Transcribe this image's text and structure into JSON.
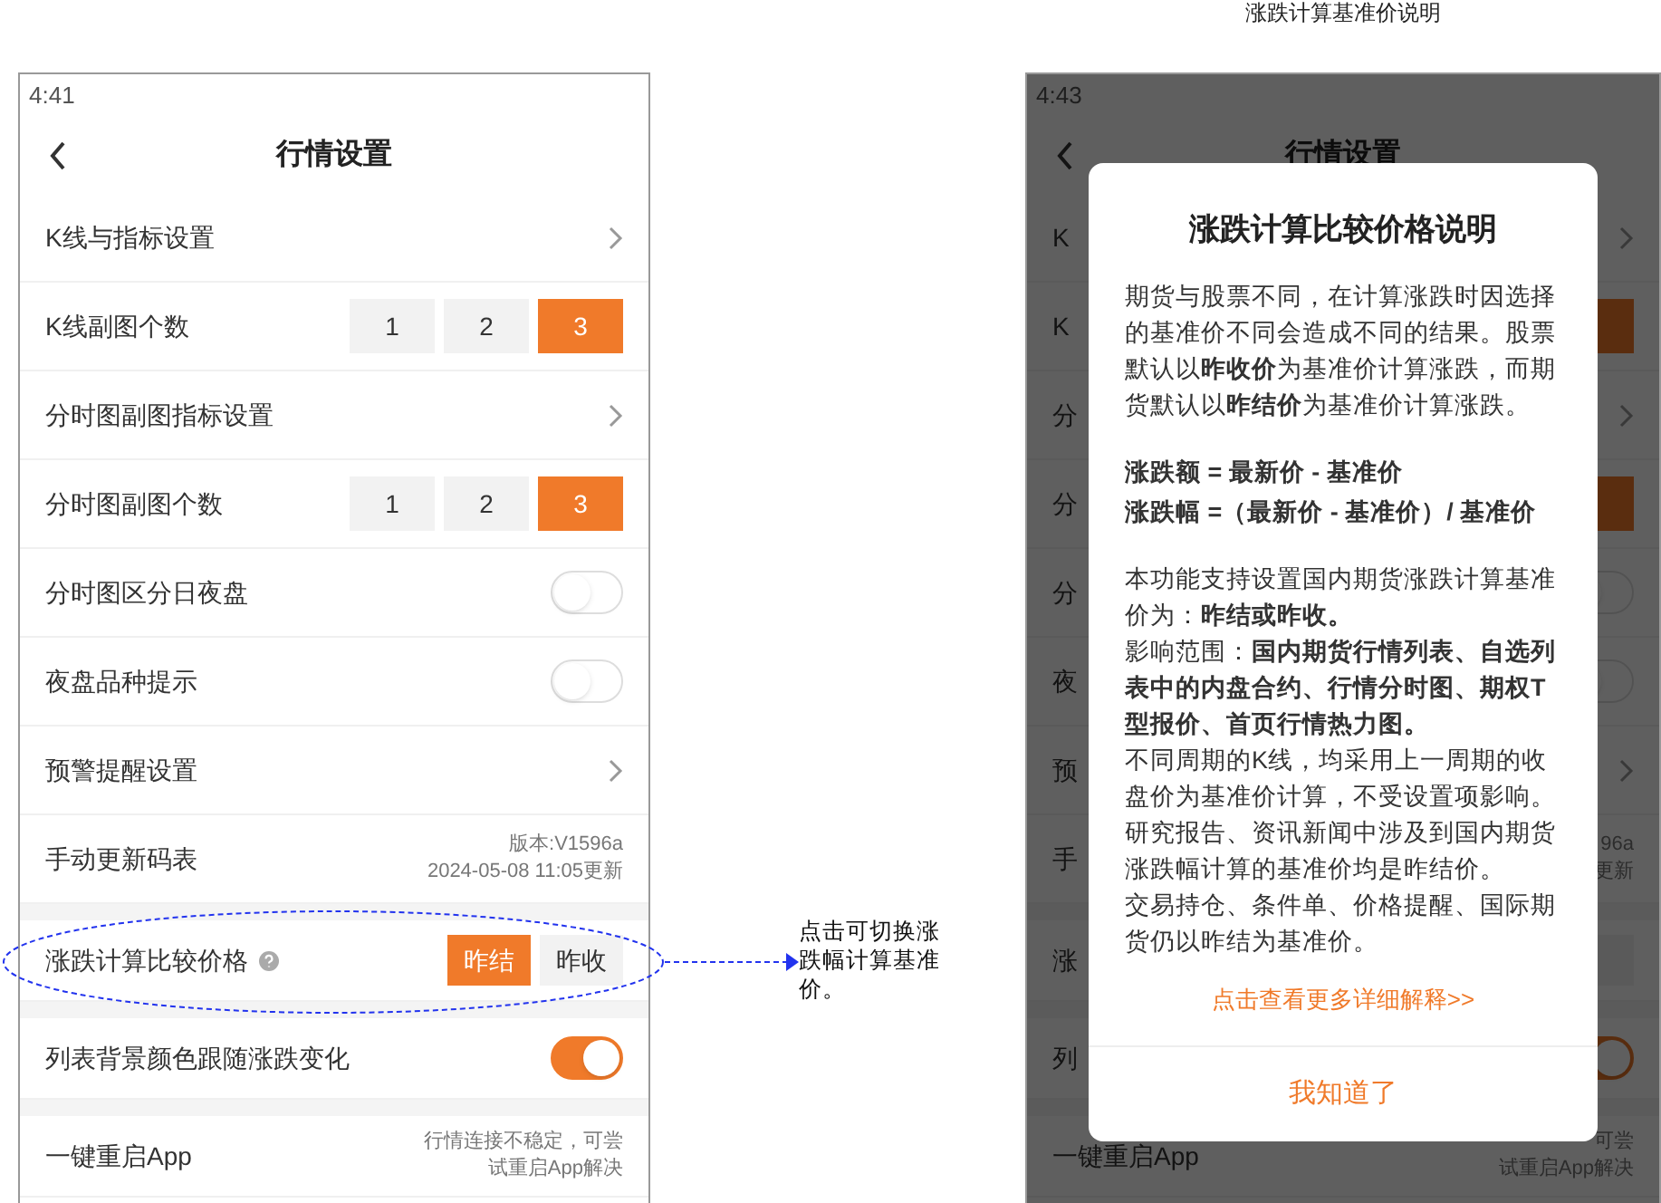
{
  "caption": "涨跌计算基准价说明",
  "annotation": "点击可切换涨跌幅计算基准价。",
  "left_screen": {
    "time": "4:41",
    "title": "行情设置",
    "sections": [
      [
        {
          "kind": "link",
          "label": "K线与指标设置"
        },
        {
          "kind": "segment",
          "label": "K线副图个数",
          "options": [
            {
              "label": "1",
              "selected": false
            },
            {
              "label": "2",
              "selected": false
            },
            {
              "label": "3",
              "selected": true
            }
          ]
        },
        {
          "kind": "link",
          "label": "分时图副图指标设置"
        },
        {
          "kind": "segment",
          "label": "分时图副图个数",
          "options": [
            {
              "label": "1",
              "selected": false
            },
            {
              "label": "2",
              "selected": false
            },
            {
              "label": "3",
              "selected": true
            }
          ]
        },
        {
          "kind": "toggle",
          "label": "分时图区分日夜盘",
          "on": false
        },
        {
          "kind": "toggle",
          "label": "夜盘品种提示",
          "on": false
        },
        {
          "kind": "link",
          "label": "预警提醒设置"
        },
        {
          "kind": "info",
          "label": "手动更新码表",
          "lines": [
            "版本:V1596a",
            "2024-05-08 11:05更新"
          ]
        }
      ],
      [
        {
          "kind": "choice",
          "label": "涨跌计算比较价格",
          "options": [
            {
              "label": "昨结",
              "selected": true
            },
            {
              "label": "昨收",
              "selected": false
            }
          ]
        }
      ],
      [
        {
          "kind": "toggle",
          "label": "列表背景颜色跟随涨跌变化",
          "on": true
        }
      ],
      [
        {
          "kind": "info",
          "label": "一键重启App",
          "lines": [
            "行情连接不稳定，可尝",
            "试重启App解决"
          ]
        }
      ]
    ]
  },
  "right_screen": {
    "time": "4:43",
    "title": "行情设置",
    "sections": [
      [
        {
          "kind": "link",
          "label": "K"
        },
        {
          "kind": "block",
          "label": "K"
        },
        {
          "kind": "link",
          "label": "分"
        },
        {
          "kind": "block",
          "label": "分"
        },
        {
          "kind": "toggle",
          "label": "分",
          "on": false
        },
        {
          "kind": "toggle",
          "label": "夜",
          "on": false
        },
        {
          "kind": "link",
          "label": "预"
        },
        {
          "kind": "info",
          "label": "手",
          "lines": [
            "96a",
            "更新"
          ]
        }
      ],
      [
        {
          "kind": "stub",
          "label": "涨"
        }
      ],
      [
        {
          "kind": "toggle",
          "label": "列",
          "on": true
        }
      ],
      [
        {
          "kind": "info",
          "label": "一键重启App",
          "lines": [
            "可尝",
            "试重启App解决"
          ]
        }
      ]
    ],
    "dialog": {
      "title": "涨跌计算比较价格说明",
      "sections": [
        [
          {
            "kind": "text",
            "text": "期货与股票不同，在计算涨跌时因选择的基准价不同会造成不同的结果。股票默认以**昨收价**为基准价计算涨跌，而期货默认以**昨结价**为基准价计算涨跌。"
          }
        ],
        [
          {
            "kind": "formula",
            "text": "涨跌额 = 最新价 - 基准价"
          },
          {
            "kind": "formula",
            "text": "涨跌幅 =（最新价 - 基准价）/ 基准价"
          }
        ],
        [
          {
            "kind": "text",
            "text": "本功能支持设置国内期货涨跌计算基准价为：**昨结或昨收。**"
          },
          {
            "kind": "text",
            "text": "影响范围：**国内期货行情列表、自选列表中的内盘合约、行情分时图、期权T型报价、首页行情热力图。**"
          },
          {
            "kind": "text",
            "text": "不同周期的K线，均采用上一周期的收盘价为基准价计算，不受设置项影响。"
          },
          {
            "kind": "text",
            "text": "研究报告、资讯新闻中涉及到国内期货涨跌幅计算的基准价均是昨结价。"
          },
          {
            "kind": "text",
            "text": "交易持仓、条件单、价格提醒、国际期货仍以昨结为基准价。"
          }
        ]
      ],
      "link": "点击查看更多详细解释>>",
      "button": "我知道了"
    }
  }
}
